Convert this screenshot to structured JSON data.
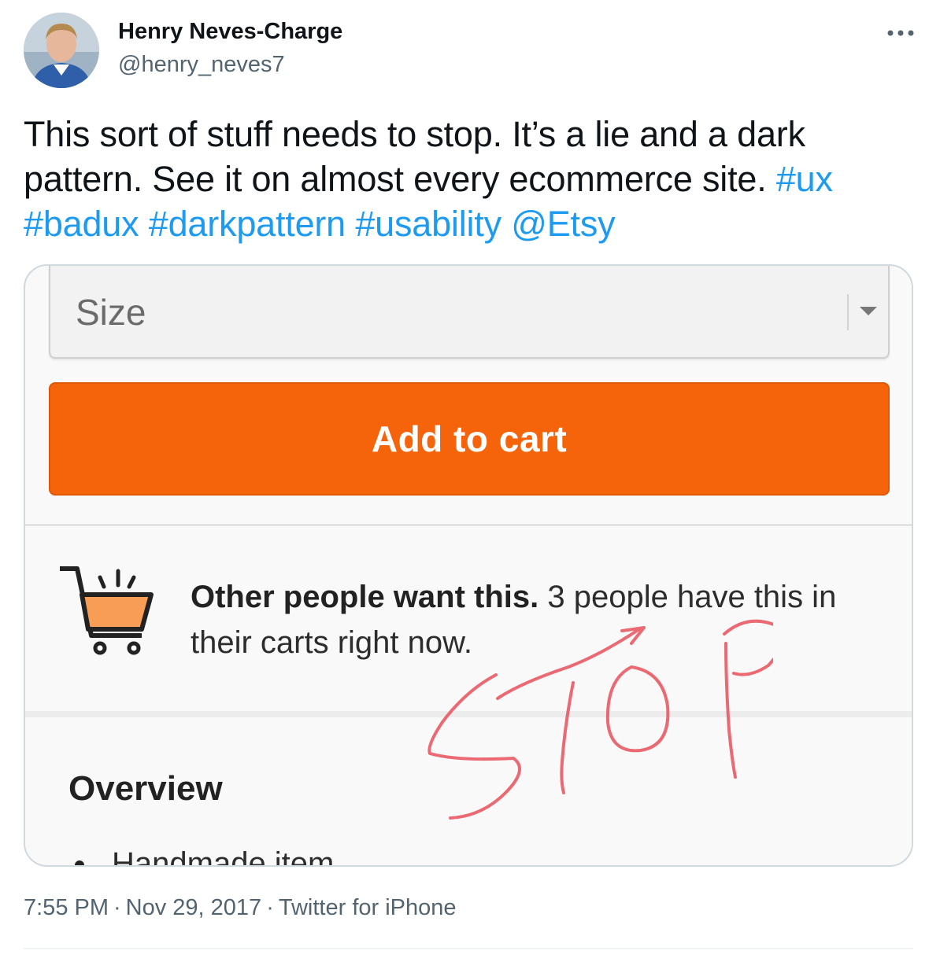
{
  "author": {
    "name": "Henry Neves-Charge",
    "handle": "@henry_neves7",
    "avatar_icon": "profile-photo"
  },
  "more_icon": "more-dots-icon",
  "tweet": {
    "text_plain": "This sort of stuff needs to stop. It’s a lie and a dark pattern. See it on almost every ecommerce site. ",
    "links": [
      "#ux",
      "#badux",
      "#darkpattern",
      "#usability",
      "@Etsy"
    ],
    "link_color": "#1d9bf0"
  },
  "media": {
    "select_label": "Size",
    "add_to_cart_label": "Add to cart",
    "button_color": "#f5640a",
    "notice_bold": "Other people want this.",
    "notice_rest": " 3 people have this in their carts right now.",
    "overview_heading": "Overview",
    "bullet_item": "Handmade item",
    "scribble_text": "STOP",
    "scribble_color": "#e8505b"
  },
  "meta": {
    "time": "7:55 PM",
    "date": "Nov 29, 2017",
    "source": "Twitter for iPhone"
  }
}
